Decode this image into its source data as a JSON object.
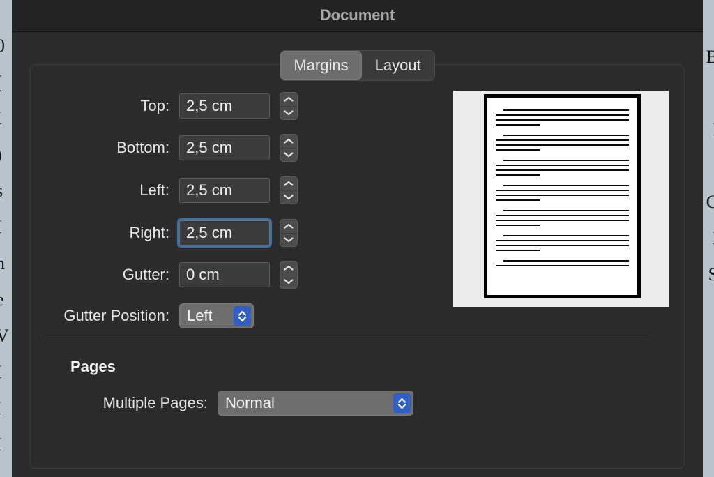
{
  "window": {
    "title": "Document"
  },
  "tabs": [
    {
      "label": "Margins",
      "selected": true
    },
    {
      "label": "Layout",
      "selected": false
    }
  ],
  "margins": {
    "fields": [
      {
        "label": "Top:",
        "value": "2,5 cm",
        "focused": false
      },
      {
        "label": "Bottom:",
        "value": "2,5 cm",
        "focused": false
      },
      {
        "label": "Left:",
        "value": "2,5 cm",
        "focused": false
      },
      {
        "label": "Right:",
        "value": "2,5 cm",
        "focused": true
      },
      {
        "label": "Gutter:",
        "value": "0 cm",
        "focused": false
      }
    ],
    "gutter_position": {
      "label": "Gutter Position:",
      "value": "Left"
    }
  },
  "pages": {
    "heading": "Pages",
    "multiple_pages": {
      "label": "Multiple Pages:",
      "value": "Normal"
    }
  },
  "preview": {
    "name": "document-page-preview",
    "paragraph_count": 7
  },
  "background_windows": {
    "left_glyphs": "0\n(\nI\n)\ns\nI\nn\ne\nV\nI\nI\nI",
    "right_glyphs": "B\n.\nI\n,\nC\nI\nS"
  },
  "colors": {
    "window_background": "#2b2b2b",
    "titlebar": "#232323",
    "title_text": "#a9a9a9",
    "text": "#e6e6e6",
    "field_background": "#3b3b3b",
    "focus_ring": "#3d6fa8",
    "popup_background": "#6e6e6e",
    "popup_chevron": "#2f5ec4",
    "selected_tab": "#6d6d6d",
    "preview_mat": "#ececec",
    "preview_page": "#ffffff",
    "desktop_sliver": "#b9c3cb"
  }
}
